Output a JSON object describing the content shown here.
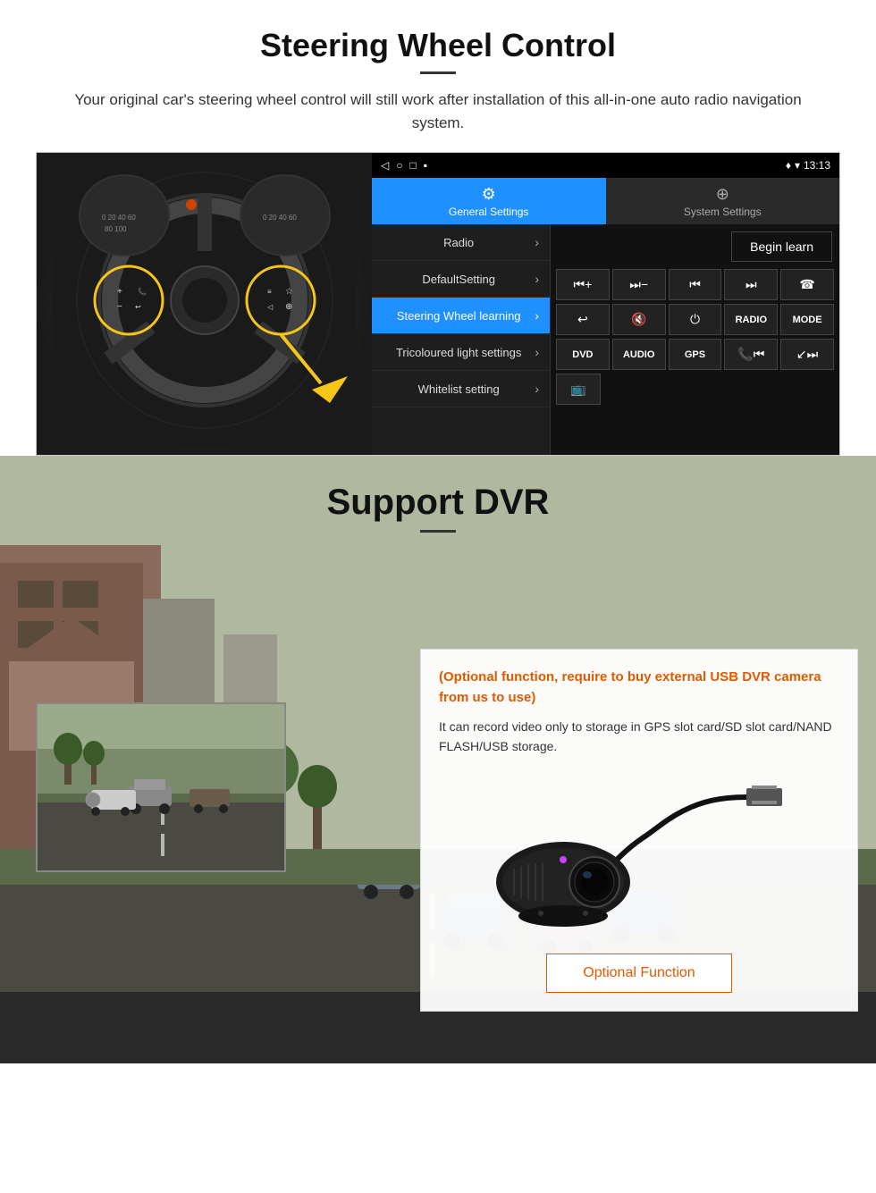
{
  "steering": {
    "title": "Steering Wheel Control",
    "subtitle": "Your original car's steering wheel control will still work after installation of this all-in-one auto radio navigation system.",
    "statusbar": {
      "icons_left": [
        "◁",
        "○",
        "□",
        "▪"
      ],
      "time": "13:13",
      "signal": "▾"
    },
    "tabs": {
      "general": "General Settings",
      "system": "System Settings"
    },
    "menu_items": [
      {
        "label": "Radio",
        "active": false
      },
      {
        "label": "DefaultSetting",
        "active": false
      },
      {
        "label": "Steering Wheel learning",
        "active": true
      },
      {
        "label": "Tricoloured light settings",
        "active": false
      },
      {
        "label": "Whitelist setting",
        "active": false
      }
    ],
    "begin_learn": "Begin learn",
    "control_buttons_row1": [
      "⏮+",
      "⏭-",
      "⏮⏮",
      "⏭⏭",
      "☎"
    ],
    "control_buttons_row2": [
      "↩",
      "🔇",
      "⏻",
      "RADIO",
      "MODE"
    ],
    "control_buttons_row3": [
      "DVD",
      "AUDIO",
      "GPS",
      "📞⏮",
      "↙⏭"
    ],
    "control_buttons_row4": [
      "📺"
    ]
  },
  "dvr": {
    "title": "Support DVR",
    "optional_text": "(Optional function, require to buy external USB DVR camera from us to use)",
    "description": "It can record video only to storage in GPS slot card/SD slot card/NAND FLASH/USB storage.",
    "optional_button": "Optional Function"
  }
}
